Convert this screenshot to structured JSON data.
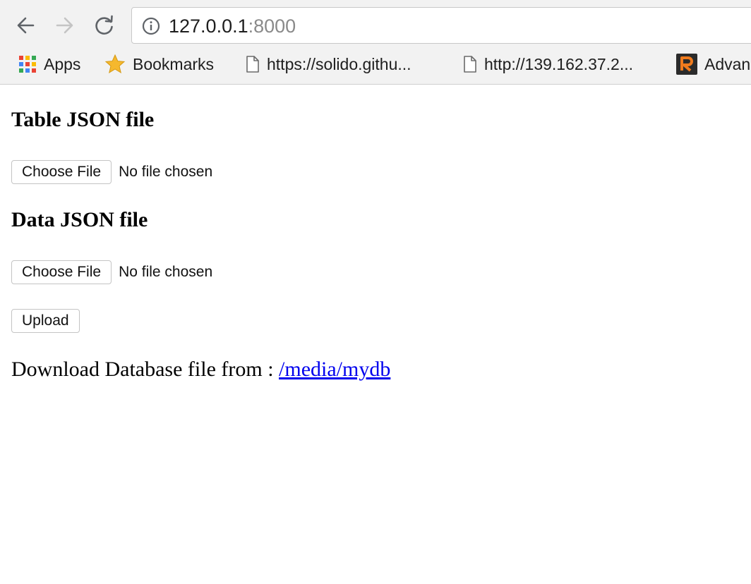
{
  "browser": {
    "url_host": "127.0.0.1",
    "url_port": ":8000",
    "bookmarks": [
      {
        "label": "Apps",
        "icon": "apps-grid-icon"
      },
      {
        "label": "Bookmarks",
        "icon": "star-icon"
      },
      {
        "label": "https://solido.githu...",
        "icon": "page-icon"
      },
      {
        "label": "http://139.162.37.2...",
        "icon": "page-icon"
      },
      {
        "label": "Advan",
        "icon": "r-logo-icon"
      }
    ]
  },
  "form": {
    "table_heading": "Table JSON file",
    "table_button": "Choose File",
    "table_status": "No file chosen",
    "data_heading": "Data JSON file",
    "data_button": "Choose File",
    "data_status": "No file chosen",
    "upload_button": "Upload"
  },
  "download": {
    "text": "Download Database file from :",
    "link_text": "/media/mydb"
  },
  "colors": {
    "link": "#0000ee",
    "chrome_bg": "#f2f2f2"
  }
}
